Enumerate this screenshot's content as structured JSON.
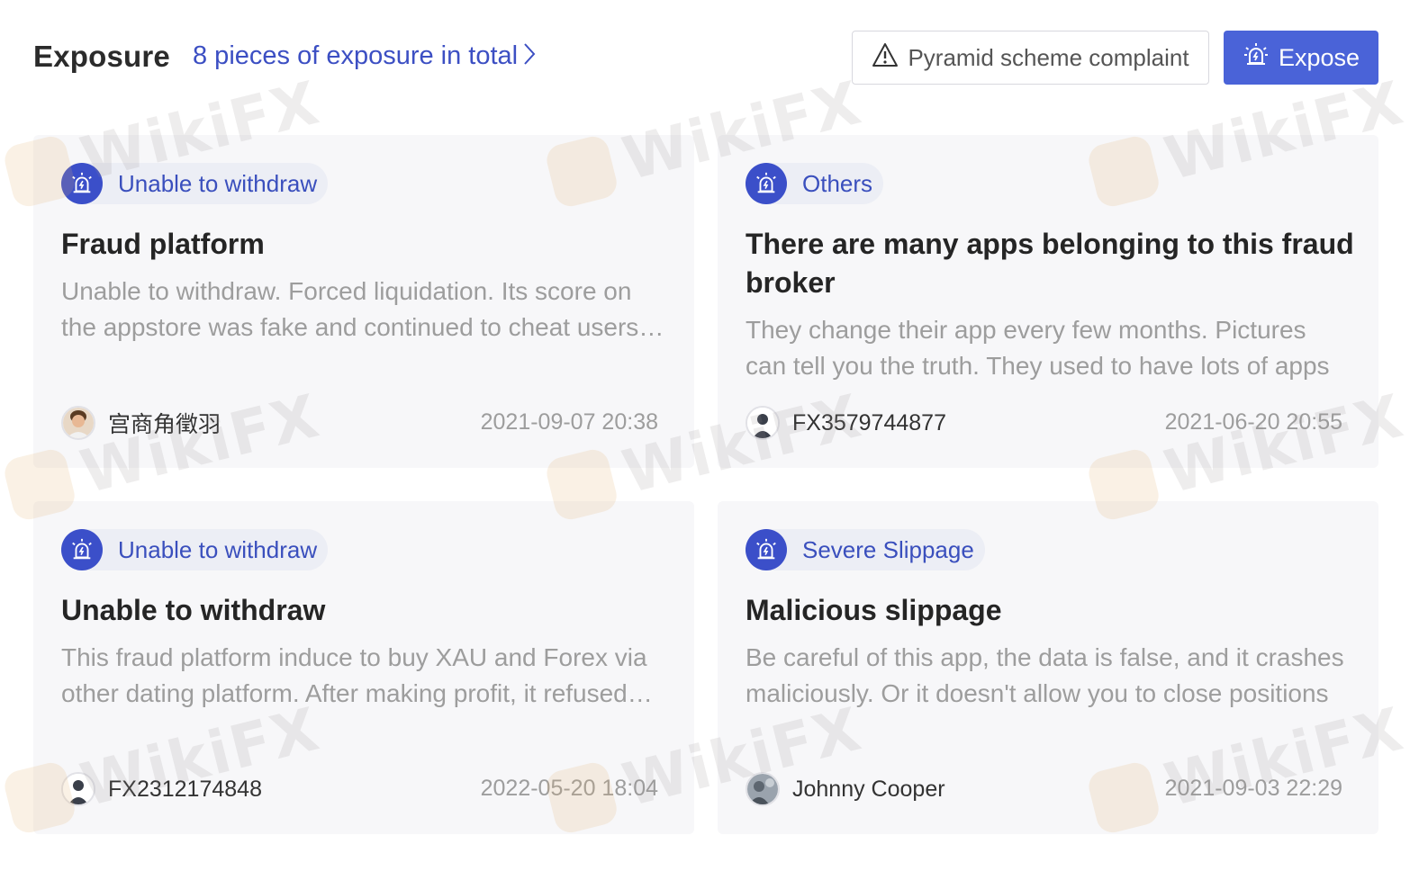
{
  "header": {
    "title": "Exposure",
    "total_link": "8 pieces of exposure in total",
    "complaint_button": "Pyramid scheme complaint",
    "expose_button": "Expose"
  },
  "cards": [
    {
      "tag": "Unable to withdraw",
      "title": "Fraud platform",
      "description": "Unable to withdraw. Forced liquidation. Its score on the appstore was fake and continued to cheat users for more deposits",
      "user": "宫商角徵羽",
      "date": "2021-09-07 20:38",
      "avatar": "photo"
    },
    {
      "tag": "Others",
      "title": "There are many apps belonging to this fraud broker",
      "description": "They change their app every few months. Pictures can tell you the truth. They used to have lots of apps",
      "user": "FX3579744877",
      "date": "2021-06-20 20:55",
      "avatar": "default"
    },
    {
      "tag": "Unable to withdraw",
      "title": "Unable to withdraw",
      "description": "This fraud platform induce to buy XAU and Forex via other dating platform. After making profit, it refused withdrawal",
      "user": "FX2312174848",
      "date": "2022-05-20 18:04",
      "avatar": "default"
    },
    {
      "tag": "Severe Slippage",
      "title": "Malicious slippage",
      "description": "Be careful of this app, the data is false, and it crashes maliciously. Or it doesn't allow you to close positions",
      "user": "Johnny Cooper",
      "date": "2021-09-03 22:29",
      "avatar": "photo-2"
    }
  ],
  "watermark": "WikiFX",
  "colors": {
    "accent": "#4a63d8",
    "tag_icon": "#3b4fc9",
    "tag_text": "#3a4fbd",
    "card_bg": "#f7f7f9",
    "muted_text": "#9d9d9d"
  }
}
